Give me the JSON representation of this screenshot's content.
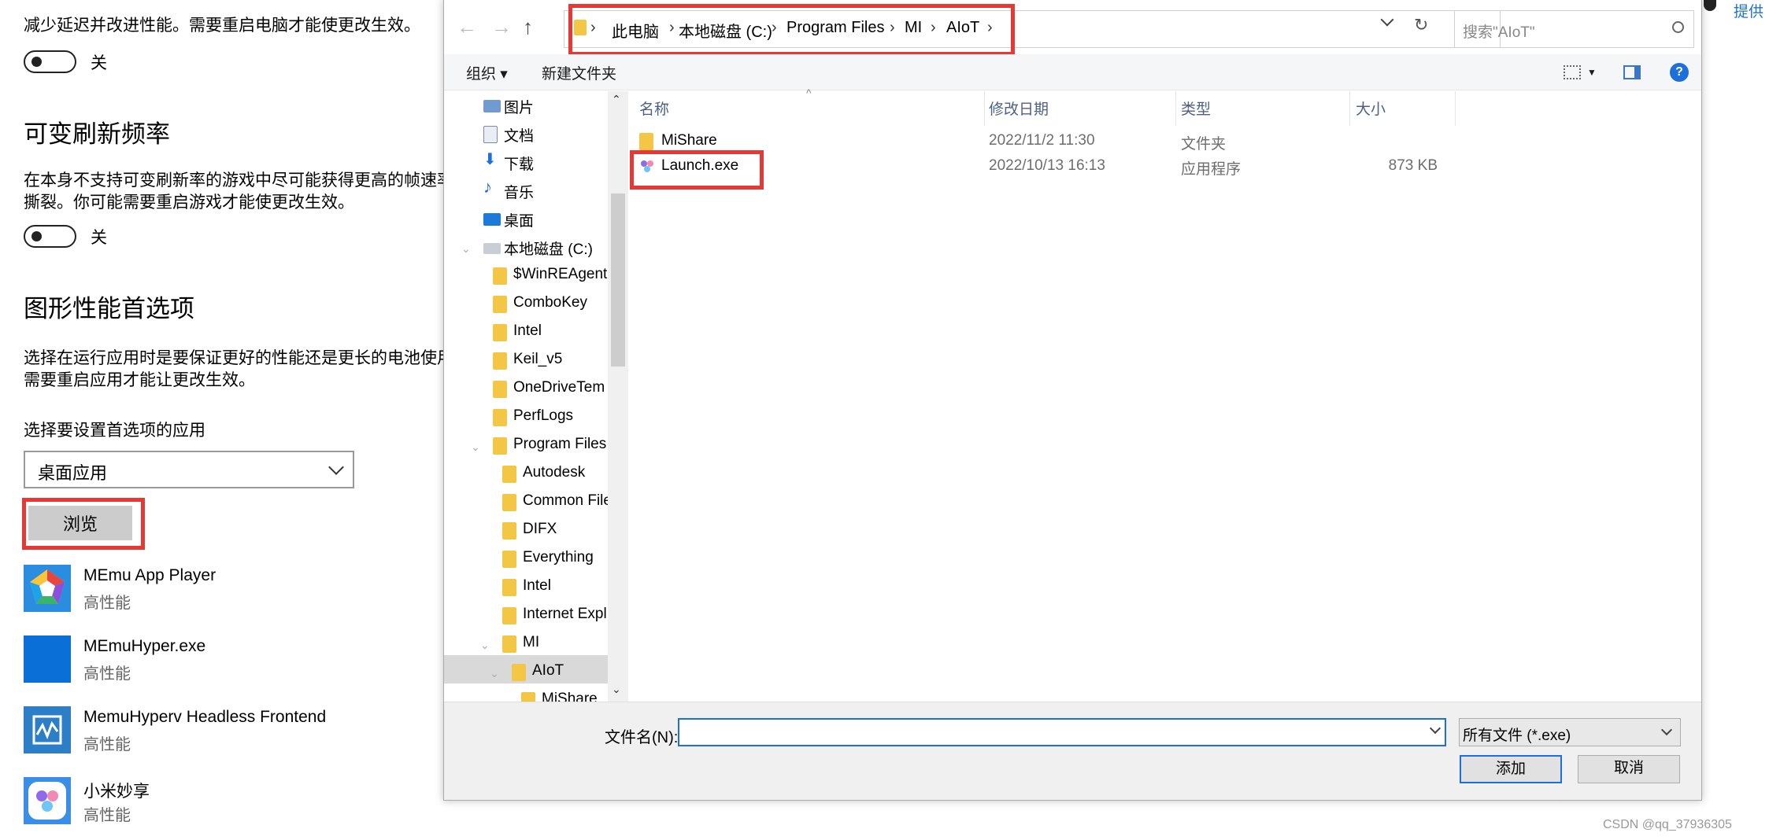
{
  "settings": {
    "top_text": "减少延迟并改进性能。需要重启电脑才能使更改生效。",
    "toggle1_label": "关",
    "vrr_heading": "可变刷新频率",
    "vrr_desc_line1": "在本身不支持可变刷新率的游戏中尽可能获得更高的帧速率",
    "vrr_desc_line2": "撕裂。你可能需要重启游戏才能使更改生效。",
    "toggle2_label": "关",
    "gfx_heading": "图形性能首选项",
    "gfx_desc_line1": "选择在运行应用时是要保证更好的性能还是更长的电池使用",
    "gfx_desc_line2": "需要重启应用才能让更改生效。",
    "select_app_label": "选择要设置首选项的应用",
    "app_type_value": "桌面应用",
    "browse_label": "浏览",
    "apps": [
      {
        "name": "MEmu App Player",
        "pref": "高性能"
      },
      {
        "name": "MEmuHyper.exe",
        "pref": "高性能"
      },
      {
        "name": "MemuHyperv Headless Frontend",
        "pref": "高性能"
      },
      {
        "name": "小米妙享",
        "pref": "高性能"
      }
    ]
  },
  "dialog": {
    "breadcrumb": [
      "此电脑",
      "本地磁盘 (C:)",
      "Program Files",
      "MI",
      "AIoT"
    ],
    "search_placeholder": "搜索\"AIoT\"",
    "toolbar": {
      "organize": "组织 ▾",
      "new_folder": "新建文件夹"
    },
    "tree": [
      {
        "label": "图片",
        "level": 0
      },
      {
        "label": "文档",
        "level": 0
      },
      {
        "label": "下载",
        "level": 0
      },
      {
        "label": "音乐",
        "level": 0
      },
      {
        "label": "桌面",
        "level": 0
      },
      {
        "label": "本地磁盘 (C:)",
        "level": 0
      },
      {
        "label": "$WinREAgent",
        "level": 1
      },
      {
        "label": "ComboKey",
        "level": 1
      },
      {
        "label": "Intel",
        "level": 1
      },
      {
        "label": "Keil_v5",
        "level": 1
      },
      {
        "label": "OneDriveTem",
        "level": 1
      },
      {
        "label": "PerfLogs",
        "level": 1
      },
      {
        "label": "Program Files",
        "level": 1
      },
      {
        "label": "Autodesk",
        "level": 2
      },
      {
        "label": "Common File",
        "level": 2
      },
      {
        "label": "DIFX",
        "level": 2
      },
      {
        "label": "Everything",
        "level": 2
      },
      {
        "label": "Intel",
        "level": 2
      },
      {
        "label": "Internet Expl",
        "level": 2
      },
      {
        "label": "MI",
        "level": 2
      },
      {
        "label": "AIoT",
        "level": 3
      },
      {
        "label": "MiShare",
        "level": 4
      }
    ],
    "columns": {
      "name": "名称",
      "date": "修改日期",
      "type": "类型",
      "size": "大小"
    },
    "files": [
      {
        "name": "MiShare",
        "date": "2022/11/2 11:30",
        "type": "文件夹",
        "size": ""
      },
      {
        "name": "Launch.exe",
        "date": "2022/10/13 16:13",
        "type": "应用程序",
        "size": "873 KB"
      }
    ],
    "filename_label": "文件名(N):",
    "filename_value": "",
    "filter_value": "所有文件 (*.exe)",
    "add_label": "添加",
    "cancel_label": "取消"
  },
  "corner_text": "提供",
  "watermark": "CSDN @qq_37936305",
  "colors": {
    "highlight_red": "#e53935",
    "accent_blue": "#1e6fd9",
    "folder_yellow": "#f3c646"
  }
}
